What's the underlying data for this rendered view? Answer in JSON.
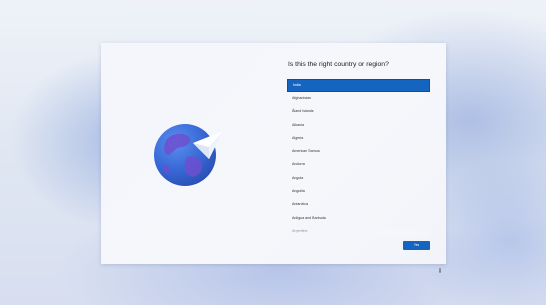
{
  "setup": {
    "title": "Is this the right country or region?",
    "selected_index": 0,
    "regions": [
      "India",
      "Afghanistan",
      "Åland Islands",
      "Albania",
      "Algeria",
      "American Samoa",
      "Andorra",
      "Angola",
      "Anguilla",
      "Antarctica",
      "Antigua and Barbuda",
      "Argentina"
    ],
    "yes_label": "Yes"
  },
  "icons": {
    "illustration": "globe-with-paper-plane-icon",
    "accessibility": "accessibility-icon"
  },
  "colors": {
    "accent": "#1565c0",
    "globe": "#3a6fd8"
  }
}
